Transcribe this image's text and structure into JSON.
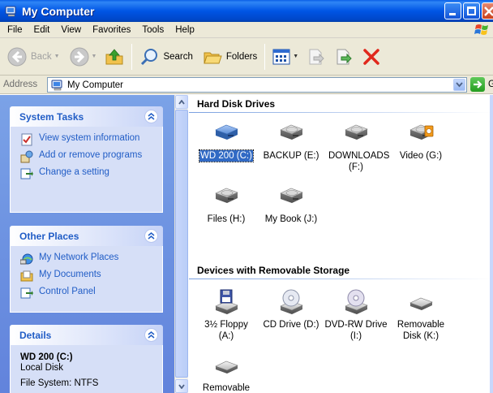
{
  "window": {
    "title": "My Computer"
  },
  "menu": [
    "File",
    "Edit",
    "View",
    "Favorites",
    "Tools",
    "Help"
  ],
  "toolbar": {
    "back_label": "Back",
    "search_label": "Search",
    "folders_label": "Folders"
  },
  "address": {
    "label": "Address",
    "value": "My Computer",
    "go_label": "Go"
  },
  "tasks": {
    "system": {
      "title": "System Tasks",
      "items": [
        "View system information",
        "Add or remove programs",
        "Change a setting"
      ]
    },
    "other": {
      "title": "Other Places",
      "items": [
        "My Network Places",
        "My Documents",
        "Control Panel"
      ]
    },
    "details": {
      "title": "Details",
      "name": "WD 200 (C:)",
      "type": "Local Disk",
      "fs": "File System: NTFS"
    }
  },
  "groups": {
    "hdd": {
      "title": "Hard Disk Drives",
      "items": [
        {
          "label": "WD 200 (C:)",
          "icon": "system-drive-icon",
          "selected": true
        },
        {
          "label": "BACKUP (E:)",
          "icon": "hard-drive-icon"
        },
        {
          "label": "DOWNLOADS (F:)",
          "icon": "hard-drive-icon"
        },
        {
          "label": "Video (G:)",
          "icon": "media-drive-icon"
        },
        {
          "label": "Files (H:)",
          "icon": "hard-drive-icon"
        },
        {
          "label": "My Book (J:)",
          "icon": "hard-drive-icon"
        }
      ]
    },
    "removable": {
      "title": "Devices with Removable Storage",
      "items": [
        {
          "label": "3½ Floppy (A:)",
          "icon": "floppy-drive-icon"
        },
        {
          "label": "CD Drive (D:)",
          "icon": "cd-drive-icon"
        },
        {
          "label": "DVD-RW Drive (I:)",
          "icon": "dvd-drive-icon"
        },
        {
          "label": "Removable Disk (K:)",
          "icon": "removable-disk-icon"
        },
        {
          "label": "Removable",
          "icon": "removable-disk-icon"
        }
      ]
    }
  },
  "colors": {
    "title_bar": "#0055e5",
    "task_pane": "#6a8fe0",
    "link": "#215dc6",
    "selection": "#316ac5"
  }
}
